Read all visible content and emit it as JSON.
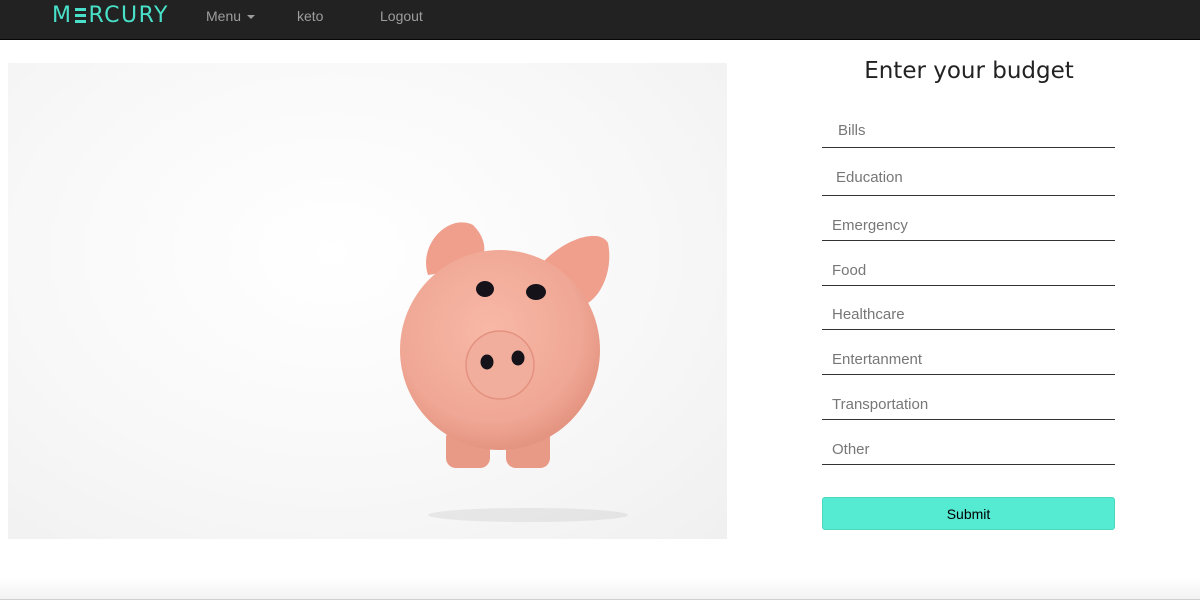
{
  "navbar": {
    "brand_left": "M",
    "brand_right": "RCURY",
    "menu_label": "Menu",
    "user_label": "keto",
    "logout_label": "Logout"
  },
  "form": {
    "title": "Enter your budget",
    "fields": [
      {
        "placeholder": "Bills"
      },
      {
        "placeholder": "Education"
      },
      {
        "placeholder": "Emergency"
      },
      {
        "placeholder": "Food"
      },
      {
        "placeholder": "Healthcare"
      },
      {
        "placeholder": "Entertanment"
      },
      {
        "placeholder": "Transportation"
      },
      {
        "placeholder": "Other"
      }
    ],
    "submit_label": "Submit"
  },
  "colors": {
    "brand": "#48e0c8",
    "navbar_bg": "#222222",
    "submit_bg": "#55ead2",
    "piggy": "#f0a795"
  },
  "icons": {
    "menu_caret": "caret-down-icon"
  }
}
